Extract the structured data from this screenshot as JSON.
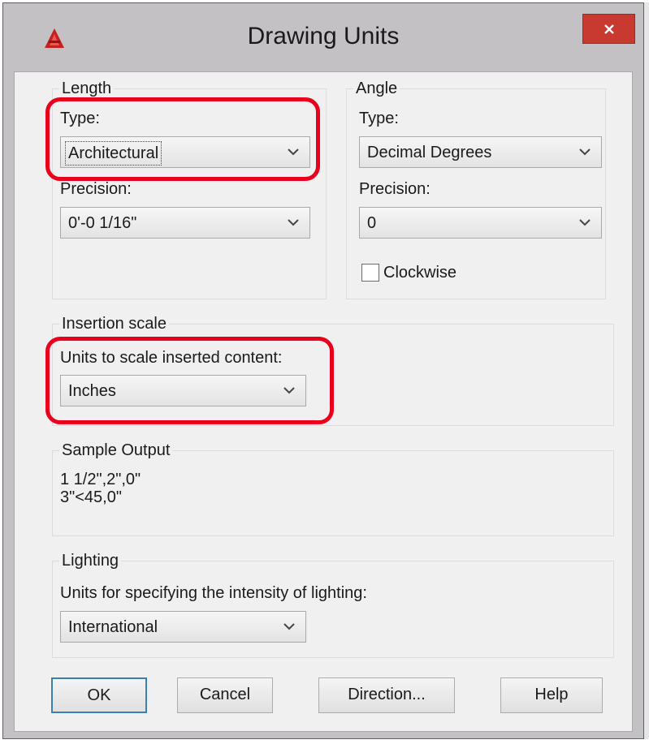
{
  "window": {
    "title": "Drawing Units",
    "close_symbol": "✕",
    "logo_icon": "autocad-logo-icon",
    "accent_color": "#c83a30"
  },
  "length": {
    "group_label": "Length",
    "type_label": "Type:",
    "type_value": "Architectural",
    "precision_label": "Precision:",
    "precision_value": "0'-0 1/16\""
  },
  "angle": {
    "group_label": "Angle",
    "type_label": "Type:",
    "type_value": "Decimal Degrees",
    "precision_label": "Precision:",
    "precision_value": "0",
    "clockwise_label": "Clockwise",
    "clockwise_checked": false
  },
  "insertion": {
    "group_label": "Insertion scale",
    "units_label": "Units to scale inserted content:",
    "units_value": "Inches"
  },
  "sample": {
    "group_label": "Sample Output",
    "line1": "1 1/2\",2\",0\"",
    "line2": "3\"<45,0\""
  },
  "lighting": {
    "group_label": "Lighting",
    "units_label": "Units for specifying the intensity of lighting:",
    "units_value": "International"
  },
  "buttons": {
    "ok": "OK",
    "cancel": "Cancel",
    "direction": "Direction...",
    "help": "Help"
  },
  "highlight_color": "#e8001c"
}
